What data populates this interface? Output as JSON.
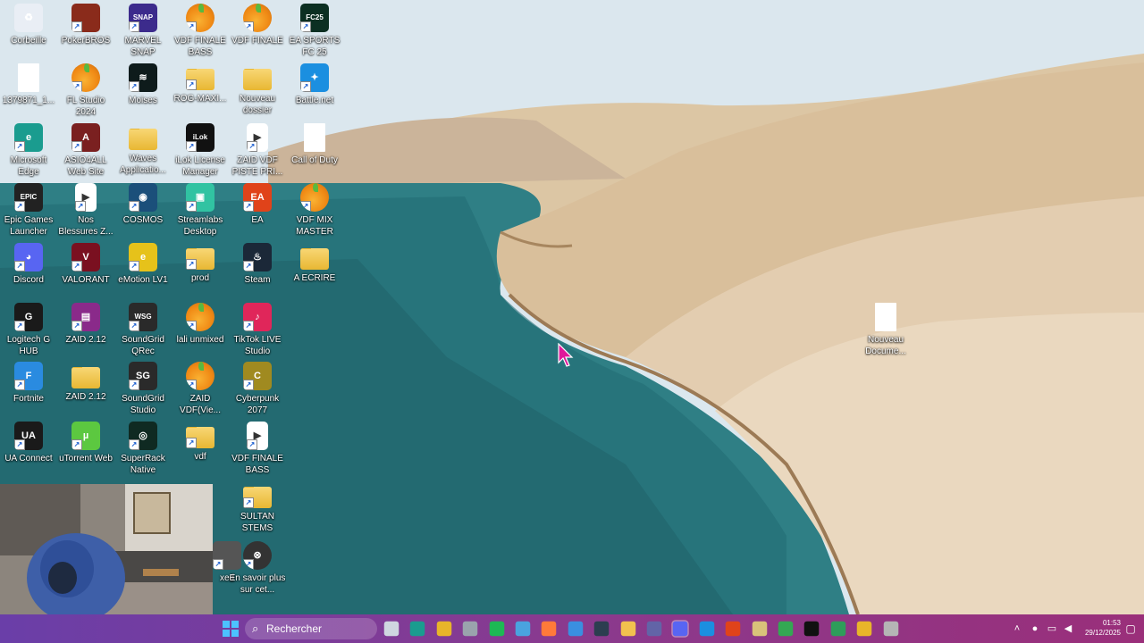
{
  "desktop_icons": [
    {
      "label": "Corbeille",
      "icon": "recycle-bin-icon"
    },
    {
      "label": "PokerBROS",
      "icon": "pokerbros-app-icon"
    },
    {
      "label": "MARVEL SNAP",
      "icon": "marvel-snap-icon"
    },
    {
      "label": "VDF FINALE BASS",
      "icon": "fl-studio-project-icon"
    },
    {
      "label": "VDF FINALE",
      "icon": "fl-studio-project-icon"
    },
    {
      "label": "EA SPORTS FC 25",
      "icon": "ea-fc25-icon"
    },
    {
      "label": "1379871_1...",
      "icon": "file-icon"
    },
    {
      "label": "FL Studio 2024",
      "icon": "fl-studio-icon"
    },
    {
      "label": "Moises",
      "icon": "moises-icon"
    },
    {
      "label": "ROG-MAXI...",
      "icon": "zip-folder-icon"
    },
    {
      "label": "Nouveau dossier",
      "icon": "folder-icon"
    },
    {
      "label": "Battle.net",
      "icon": "battlenet-icon"
    },
    {
      "label": "Microsoft Edge",
      "icon": "edge-icon"
    },
    {
      "label": "ASIO4ALL Web Site",
      "icon": "asio4all-icon"
    },
    {
      "label": "Waves Applicatio...",
      "icon": "folder-icon"
    },
    {
      "label": "iLok License Manager",
      "icon": "ilok-icon"
    },
    {
      "label": "ZAID VDF PISTE PRI...",
      "icon": "video-file-icon"
    },
    {
      "label": "Call of Duty",
      "icon": "file-icon"
    },
    {
      "label": "Epic Games Launcher",
      "icon": "epic-games-icon"
    },
    {
      "label": "Nos Blessures Z...",
      "icon": "video-file-icon"
    },
    {
      "label": "COSMOS",
      "icon": "cosmos-icon"
    },
    {
      "label": "Streamlabs Desktop",
      "icon": "streamlabs-icon"
    },
    {
      "label": "EA",
      "icon": "ea-app-icon"
    },
    {
      "label": "VDF MIX MASTER",
      "icon": "fl-studio-project-icon"
    },
    {
      "label": "Discord",
      "icon": "discord-icon"
    },
    {
      "label": "VALORANT",
      "icon": "valorant-icon"
    },
    {
      "label": "eMotion LV1",
      "icon": "emotion-lv1-icon"
    },
    {
      "label": "prod",
      "icon": "zip-folder-icon"
    },
    {
      "label": "Steam",
      "icon": "steam-icon"
    },
    {
      "label": "A ECRIRE",
      "icon": "folder-icon"
    },
    {
      "label": "Logitech G HUB",
      "icon": "logitech-ghub-icon"
    },
    {
      "label": "ZAID 2.12",
      "icon": "winrar-icon"
    },
    {
      "label": "SoundGrid QRec",
      "icon": "soundgrid-qrec-icon"
    },
    {
      "label": "lali unmixed",
      "icon": "fl-studio-project-icon"
    },
    {
      "label": "TikTok LIVE Studio",
      "icon": "tiktok-live-icon"
    },
    {
      "label": "Fortnite",
      "icon": "fortnite-icon"
    },
    {
      "label": "ZAID 2.12",
      "icon": "folder-icon"
    },
    {
      "label": "SoundGrid Studio",
      "icon": "soundgrid-studio-icon"
    },
    {
      "label": "ZAID VDF(Vie...",
      "icon": "fl-studio-project-icon"
    },
    {
      "label": "Cyberpunk 2077",
      "icon": "cyberpunk-icon"
    },
    {
      "label": "UA Connect",
      "icon": "ua-connect-icon"
    },
    {
      "label": "uTorrent Web",
      "icon": "utorrent-icon"
    },
    {
      "label": "SuperRack Native",
      "icon": "superrack-icon"
    },
    {
      "label": "vdf",
      "icon": "zip-folder-icon"
    },
    {
      "label": "VDF FINALE BASS",
      "icon": "video-file-icon"
    },
    {
      "label": "SULTAN STEMS",
      "icon": "zip-folder-icon"
    },
    {
      "label": "xed",
      "icon": "app-icon"
    },
    {
      "label": "En savoir plus sur cet...",
      "icon": "info-icon"
    },
    {
      "label": "Nouveau Docume...",
      "icon": "text-document-icon"
    }
  ],
  "taskbar": {
    "search_placeholder": "Rechercher",
    "start_icon": "windows-start-icon",
    "pinned_apps": [
      "task-view-icon",
      "edge-icon",
      "chrome-icon",
      "calculator-icon",
      "spotify-icon",
      "widgets-icon",
      "capcut-icon",
      "screen-tool-icon",
      "terminal-icon",
      "file-explorer-icon",
      "teams-icon",
      "discord-icon",
      "battlenet-icon",
      "ea-app-icon",
      "dev-tool-icon",
      "chrome-profile-icon",
      "logitech-ghub-icon",
      "capture-app-icon",
      "chrome-icon",
      "pokerbros-app-icon"
    ],
    "tray": [
      "chevron-up-icon",
      "microphone-icon",
      "network-icon",
      "speaker-icon"
    ],
    "time": "01:53",
    "date": "29/12/2025",
    "notification_icon": "notification-icon"
  },
  "webcam_overlay": {
    "content": "webcam-feed"
  },
  "colors": {
    "taskbar_start": "#6a3ea8",
    "taskbar_end": "#9a2f7a"
  }
}
